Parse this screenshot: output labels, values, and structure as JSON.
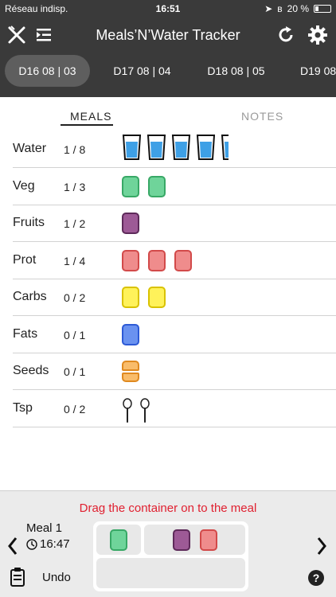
{
  "status_bar": {
    "carrier": "Réseau indisp.",
    "time": "16:51",
    "battery": "20 %"
  },
  "header": {
    "title": "Meals’N’Water Tracker",
    "icons": [
      "fork-knife-icon",
      "menu-indent-icon",
      "refresh-icon",
      "gear-icon"
    ]
  },
  "date_tabs": [
    {
      "label": "D16 08 | 03",
      "active": true
    },
    {
      "label": "D17 08 | 04",
      "active": false
    },
    {
      "label": "D18 08 | 05",
      "active": false
    },
    {
      "label": "D19 08",
      "active": false
    }
  ],
  "segments": {
    "meals": "MEALS",
    "notes": "NOTES",
    "active": "meals"
  },
  "rows": [
    {
      "name": "Water",
      "count": "1 / 8",
      "kind": "glass",
      "items": 5,
      "color": "#3ea0e6"
    },
    {
      "name": "Veg",
      "count": "1 / 3",
      "kind": "box",
      "items": 2,
      "color": "#6fd49a",
      "border": "#38a866"
    },
    {
      "name": "Fruits",
      "count": "1 / 2",
      "kind": "box",
      "items": 1,
      "color": "#9d5a96",
      "border": "#5e2a5a"
    },
    {
      "name": "Prot",
      "count": "1 / 4",
      "kind": "box",
      "items": 3,
      "color": "#ef8c8c",
      "border": "#d24a4a"
    },
    {
      "name": "Carbs",
      "count": "0 / 2",
      "kind": "box",
      "items": 2,
      "color": "#fff25a",
      "border": "#d9c200"
    },
    {
      "name": "Fats",
      "count": "0 / 1",
      "kind": "box",
      "items": 1,
      "color": "#6a92f0",
      "border": "#2d5ad6"
    },
    {
      "name": "Seeds",
      "count": "0 / 1",
      "kind": "halfbox",
      "items": 1,
      "color": "#f9bc6a",
      "border": "#e08a20"
    },
    {
      "name": "Tsp",
      "count": "0 / 2",
      "kind": "spoon",
      "items": 2,
      "color": "#ffffff",
      "border": "#333333"
    }
  ],
  "bottom": {
    "hint": "Drag the container on to the meal",
    "meal_name": "Meal 1",
    "meal_time": "16:47",
    "undo": "Undo"
  }
}
